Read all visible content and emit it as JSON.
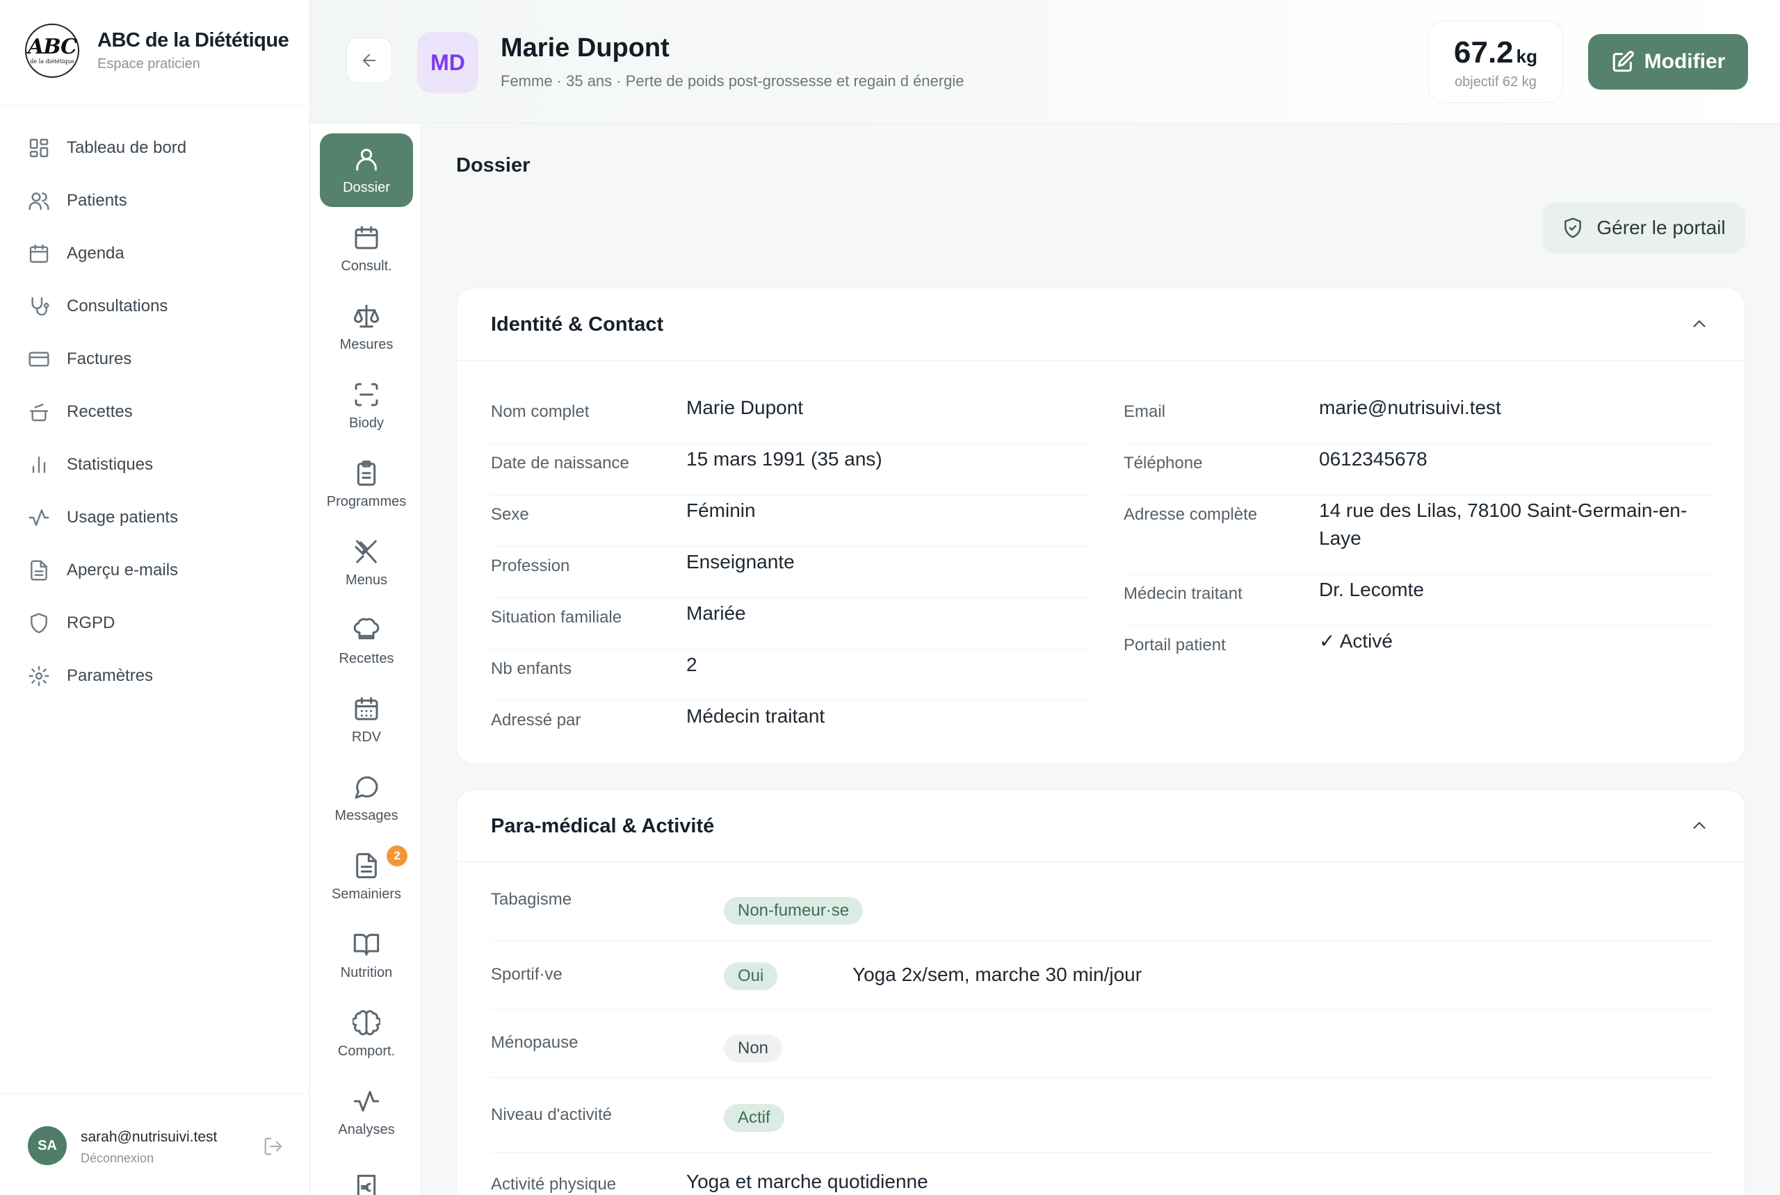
{
  "brand": {
    "logo_text": "ABC",
    "logo_small": "de la diététique",
    "title": "ABC de la Diététique",
    "subtitle": "Espace praticien"
  },
  "nav": {
    "items": [
      {
        "label": "Tableau de bord",
        "icon": "dashboard-icon"
      },
      {
        "label": "Patients",
        "icon": "users-icon"
      },
      {
        "label": "Agenda",
        "icon": "calendar-icon"
      },
      {
        "label": "Consultations",
        "icon": "stethoscope-icon"
      },
      {
        "label": "Factures",
        "icon": "credit-card-icon"
      },
      {
        "label": "Recettes",
        "icon": "cooking-pot-icon"
      },
      {
        "label": "Statistiques",
        "icon": "bar-chart-icon"
      },
      {
        "label": "Usage patients",
        "icon": "activity-icon"
      },
      {
        "label": "Aperçu e-mails",
        "icon": "file-text-icon"
      },
      {
        "label": "RGPD",
        "icon": "shield-icon"
      },
      {
        "label": "Paramètres",
        "icon": "gear-icon"
      }
    ]
  },
  "user": {
    "initials": "SA",
    "email": "sarah@nutrisuivi.test",
    "logout": "Déconnexion"
  },
  "subnav": {
    "items": [
      {
        "label": "Dossier",
        "icon": "user-icon",
        "active": true
      },
      {
        "label": "Consult.",
        "icon": "calendar-icon"
      },
      {
        "label": "Mesures",
        "icon": "scale-icon"
      },
      {
        "label": "Biody",
        "icon": "scan-icon"
      },
      {
        "label": "Programmes",
        "icon": "clipboard-icon"
      },
      {
        "label": "Menus",
        "icon": "utensils-icon"
      },
      {
        "label": "Recettes",
        "icon": "chef-hat-icon"
      },
      {
        "label": "RDV",
        "icon": "calendar-days-icon"
      },
      {
        "label": "Messages",
        "icon": "message-icon"
      },
      {
        "label": "Semainiers",
        "icon": "document-icon",
        "badge": "2"
      },
      {
        "label": "Nutrition",
        "icon": "book-icon"
      },
      {
        "label": "Comport.",
        "icon": "brain-icon"
      },
      {
        "label": "Analyses",
        "icon": "pulse-icon"
      },
      {
        "label": "",
        "icon": "euro-receipt-icon"
      }
    ]
  },
  "header": {
    "initials": "MD",
    "name": "Marie Dupont",
    "meta": "Femme · 35 ans · Perte de poids post-grossesse et regain d énergie",
    "weight_value": "67.2",
    "weight_unit": "kg",
    "weight_goal": "objectif 62 kg",
    "edit_label": "Modifier"
  },
  "content": {
    "section_title": "Dossier",
    "portal_button": "Gérer le portail"
  },
  "identity": {
    "title": "Identité & Contact",
    "left": [
      {
        "label": "Nom complet",
        "value": "Marie Dupont"
      },
      {
        "label": "Date de naissance",
        "value": "15 mars 1991 (35 ans)"
      },
      {
        "label": "Sexe",
        "value": "Féminin"
      },
      {
        "label": "Profession",
        "value": "Enseignante"
      },
      {
        "label": "Situation familiale",
        "value": "Mariée"
      },
      {
        "label": "Nb enfants",
        "value": "2"
      },
      {
        "label": "Adressé par",
        "value": "Médecin traitant"
      }
    ],
    "right": [
      {
        "label": "Email",
        "value": "marie@nutrisuivi.test"
      },
      {
        "label": "Téléphone",
        "value": "0612345678"
      },
      {
        "label": "Adresse complète",
        "value": "14 rue des Lilas, 78100 Saint-Germain-en-Laye"
      },
      {
        "label": "Médecin traitant",
        "value": "Dr. Lecomte"
      },
      {
        "label": "Portail patient",
        "value": "✓ Activé"
      }
    ]
  },
  "para": {
    "title": "Para-médical & Activité",
    "rows": [
      {
        "label": "Tabagisme",
        "pill": "Non-fumeur·se",
        "pill_color": "#dcebe3"
      },
      {
        "label": "Sportif·ve",
        "pill": "Oui",
        "pill_color": "#dcebe3",
        "extra": "Yoga 2x/sem, marche 30 min/jour"
      },
      {
        "label": "Ménopause",
        "pill": "Non",
        "pill_color": "#f0f2f1"
      },
      {
        "label": "Niveau d'activité",
        "pill": "Actif",
        "pill_color": "#dcebe3"
      },
      {
        "label": "Activité physique",
        "value": "Yoga et marche quotidienne"
      }
    ]
  },
  "colors": {
    "accent": "#56816d",
    "avatar_bg": "#ece4fb",
    "avatar_text": "#7c3aed",
    "badge": "#f59636"
  }
}
